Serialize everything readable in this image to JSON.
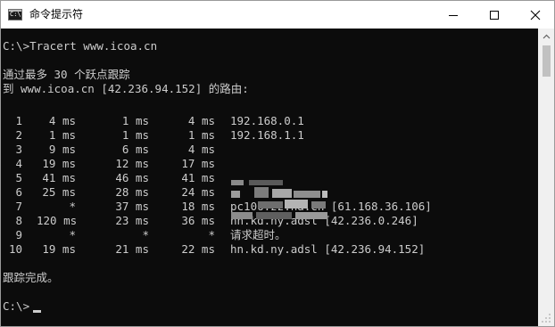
{
  "window": {
    "title": "命令提示符",
    "icon_text": "C:\\"
  },
  "controls": {
    "minimize_icon": "minimize-icon",
    "maximize_icon": "maximize-icon",
    "close_icon": "close-icon"
  },
  "console": {
    "command_line": "C:\\>Tracert www.icoa.cn",
    "header1": "通过最多 30 个跃点跟踪",
    "header2": "到 www.icoa.cn [42.236.94.152] 的路由:",
    "hops": [
      {
        "n": "1",
        "t1": "4 ms",
        "t2": "1 ms",
        "t3": "4 ms",
        "host": "192.168.0.1"
      },
      {
        "n": "2",
        "t1": "1 ms",
        "t2": "1 ms",
        "t3": "1 ms",
        "host": "192.168.1.1"
      },
      {
        "n": "3",
        "t1": "9 ms",
        "t2": "6 ms",
        "t3": "4 ms",
        "host": ""
      },
      {
        "n": "4",
        "t1": "19 ms",
        "t2": "12 ms",
        "t3": "17 ms",
        "host": ""
      },
      {
        "n": "5",
        "t1": "41 ms",
        "t2": "46 ms",
        "t3": "41 ms",
        "host": ""
      },
      {
        "n": "6",
        "t1": "25 ms",
        "t2": "28 ms",
        "t3": "24 ms",
        "host": ""
      },
      {
        "n": "7",
        "t1": "*",
        "t2": "37 ms",
        "t3": "18 ms",
        "host": "pc106.zz.ha.cn [61.168.36.106]"
      },
      {
        "n": "8",
        "t1": "120 ms",
        "t2": "23 ms",
        "t3": "36 ms",
        "host": "hn.kd.ny.adsl [42.236.0.246]"
      },
      {
        "n": "9",
        "t1": "*",
        "t2": "*",
        "t3": "*",
        "host": "请求超时。"
      },
      {
        "n": "10",
        "t1": "19 ms",
        "t2": "21 ms",
        "t3": "22 ms",
        "host": "hn.kd.ny.adsl [42.236.94.152]"
      }
    ],
    "complete": "跟踪完成。",
    "prompt": "C:\\>"
  }
}
